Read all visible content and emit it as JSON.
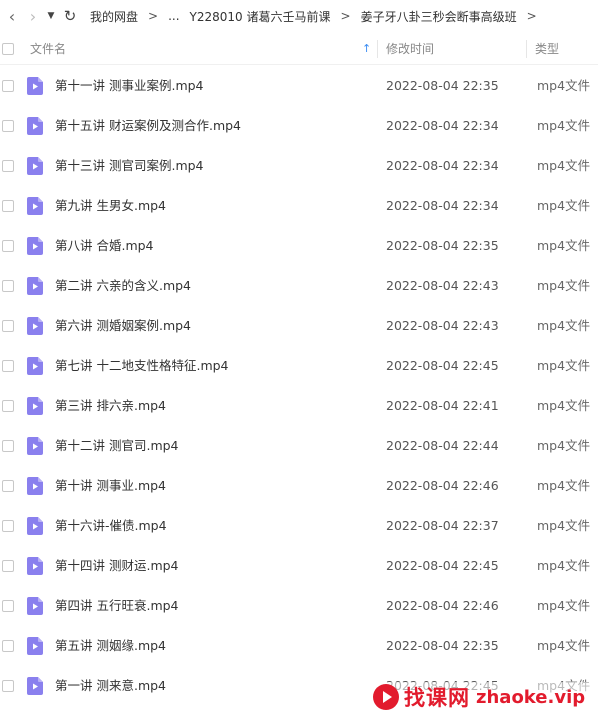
{
  "breadcrumb": {
    "root": "我的网盘",
    "ellipsis": "...",
    "parent": "Y228010 诸葛六壬马前课",
    "current": "姜子牙八卦三秒会断事高级班"
  },
  "columns": {
    "name": "文件名",
    "modified": "修改时间",
    "type": "类型"
  },
  "files": [
    {
      "name": "第十一讲 测事业案例.mp4",
      "modified": "2022-08-04 22:35",
      "type": "mp4文件"
    },
    {
      "name": "第十五讲 财运案例及测合作.mp4",
      "modified": "2022-08-04 22:34",
      "type": "mp4文件"
    },
    {
      "name": "第十三讲 测官司案例.mp4",
      "modified": "2022-08-04 22:34",
      "type": "mp4文件"
    },
    {
      "name": "第九讲  生男女.mp4",
      "modified": "2022-08-04 22:34",
      "type": "mp4文件"
    },
    {
      "name": "第八讲 合婚.mp4",
      "modified": "2022-08-04 22:35",
      "type": "mp4文件"
    },
    {
      "name": "第二讲 六亲的含义.mp4",
      "modified": "2022-08-04 22:43",
      "type": "mp4文件"
    },
    {
      "name": "第六讲 测婚姻案例.mp4",
      "modified": "2022-08-04 22:43",
      "type": "mp4文件"
    },
    {
      "name": "第七讲 十二地支性格特征.mp4",
      "modified": "2022-08-04 22:45",
      "type": "mp4文件"
    },
    {
      "name": "第三讲 排六亲.mp4",
      "modified": "2022-08-04 22:41",
      "type": "mp4文件"
    },
    {
      "name": "第十二讲 测官司.mp4",
      "modified": "2022-08-04 22:44",
      "type": "mp4文件"
    },
    {
      "name": "第十讲 测事业.mp4",
      "modified": "2022-08-04 22:46",
      "type": "mp4文件"
    },
    {
      "name": "第十六讲-催债.mp4",
      "modified": "2022-08-04 22:37",
      "type": "mp4文件"
    },
    {
      "name": "第十四讲 测财运.mp4",
      "modified": "2022-08-04 22:45",
      "type": "mp4文件"
    },
    {
      "name": "第四讲 五行旺衰.mp4",
      "modified": "2022-08-04 22:46",
      "type": "mp4文件"
    },
    {
      "name": "第五讲 测姻缘.mp4",
      "modified": "2022-08-04 22:35",
      "type": "mp4文件"
    },
    {
      "name": "第一讲 测来意.mp4",
      "modified": "2022-08-04 22:45",
      "type": "mp4文件"
    }
  ],
  "icons": {
    "file": "video-file-icon",
    "back": "chevron-left-icon",
    "forward": "chevron-right-icon",
    "history": "caret-down-icon",
    "refresh": "refresh-icon",
    "sort": "sort-ascending-icon"
  },
  "colors": {
    "file_icon": "#8a80ee",
    "sort_arrow": "#3b8cf2",
    "watermark": "#e21b2d"
  },
  "watermark": {
    "cn": "找课网",
    "en": "zhaoke.vip"
  }
}
